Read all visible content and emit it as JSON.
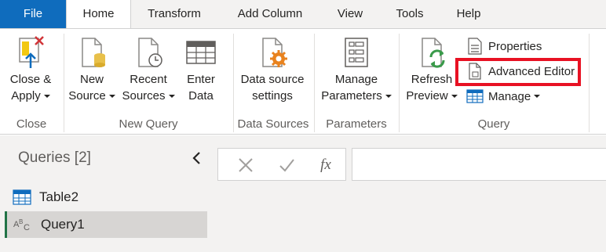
{
  "tabs": {
    "file": "File",
    "home": "Home",
    "transform": "Transform",
    "add_column": "Add Column",
    "view": "View",
    "tools": "Tools",
    "help": "Help"
  },
  "ribbon": {
    "close_group": {
      "label": "Close",
      "close_apply": [
        "Close &",
        "Apply"
      ]
    },
    "new_query_group": {
      "label": "New Query",
      "new_source": [
        "New",
        "Source"
      ],
      "recent_sources": [
        "Recent",
        "Sources"
      ],
      "enter_data": [
        "Enter",
        "Data"
      ]
    },
    "data_sources_group": {
      "label": "Data Sources",
      "data_source_settings": [
        "Data source",
        "settings"
      ]
    },
    "parameters_group": {
      "label": "Parameters",
      "manage_parameters": [
        "Manage",
        "Parameters"
      ]
    },
    "query_group": {
      "label": "Query",
      "refresh_preview": [
        "Refresh",
        "Preview"
      ],
      "properties": "Properties",
      "advanced_editor": "Advanced Editor",
      "manage": "Manage"
    }
  },
  "queries_pane": {
    "title": "Queries [2]",
    "items": [
      {
        "name": "Table2",
        "icon": "table-icon",
        "selected": false
      },
      {
        "name": "Query1",
        "icon": "abc-text-icon",
        "selected": true
      }
    ]
  },
  "formula_bar": {
    "fx": "fx",
    "value": ""
  },
  "colors": {
    "file_tab": "#0f6cbd",
    "highlight": "#e81123",
    "selected_accent": "#217346",
    "refresh_green": "#3a9a4a",
    "settings_orange": "#e8821e"
  }
}
